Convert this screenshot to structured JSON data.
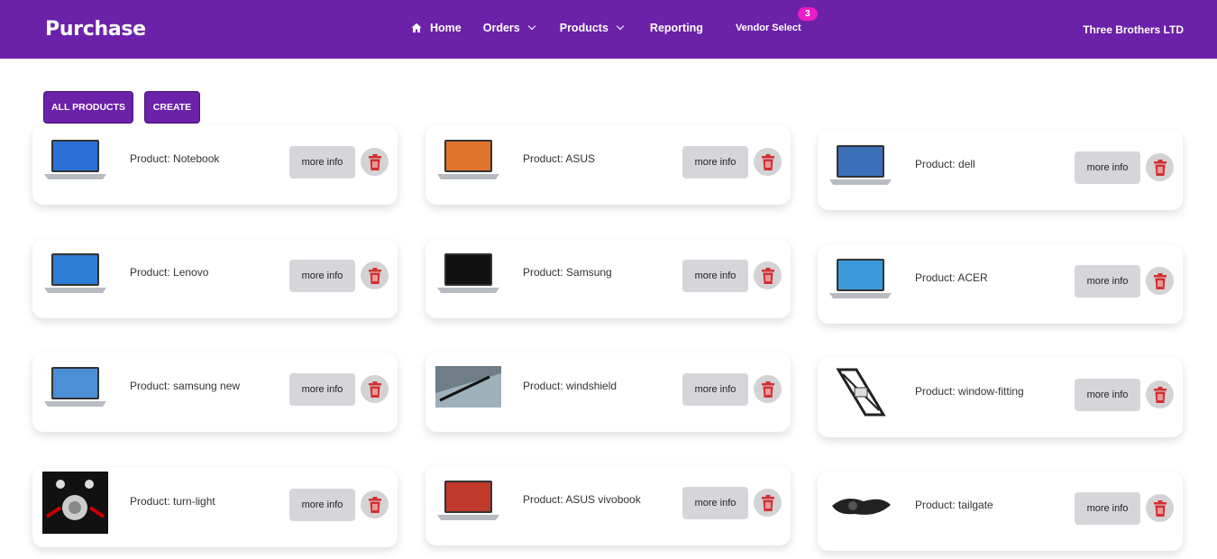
{
  "navbar": {
    "brand": "Purchase",
    "links": {
      "home": "Home",
      "orders": "Orders",
      "products": "Products",
      "reporting": "Reporting",
      "vendor_select": "Vendor Select"
    },
    "vendor_badge": "3",
    "company": "Three Brothers LTD",
    "color": "#6b21a8",
    "badge_color": "#e91ec5"
  },
  "actions": {
    "all_products": "ALL PRODUCTS",
    "create": "CREATE"
  },
  "products": [
    {
      "label": "Product: Notebook",
      "more": "more info",
      "icon": "laptop-windows8-icon"
    },
    {
      "label": "Product: ASUS",
      "more": "more info",
      "icon": "laptop-asus-icon"
    },
    {
      "label": "Product: dell",
      "more": "more info",
      "icon": "laptop-dell-icon"
    },
    {
      "label": "Product: Lenovo",
      "more": "more info",
      "icon": "laptop-windows7-icon"
    },
    {
      "label": "Product: Samsung",
      "more": "more info",
      "icon": "laptop-black-screen-icon"
    },
    {
      "label": "Product: ACER",
      "more": "more info",
      "icon": "laptop-acer-icon"
    },
    {
      "label": "Product: samsung new",
      "more": "more info",
      "icon": "convertible-laptop-icon"
    },
    {
      "label": "Product: windshield",
      "more": "more info",
      "icon": "windshield-wiper-icon"
    },
    {
      "label": "Product: window-fitting",
      "more": "more info",
      "icon": "window-regulator-icon"
    },
    {
      "label": "Product: turn-light",
      "more": "more info",
      "icon": "turn-light-bulb-icon"
    },
    {
      "label": "Product: ASUS vivobook",
      "more": "more info",
      "icon": "laptop-vivobook-icon"
    },
    {
      "label": "Product: tailgate",
      "more": "more info",
      "icon": "tailgate-part-icon"
    }
  ],
  "trash_color": "#d32f2f"
}
